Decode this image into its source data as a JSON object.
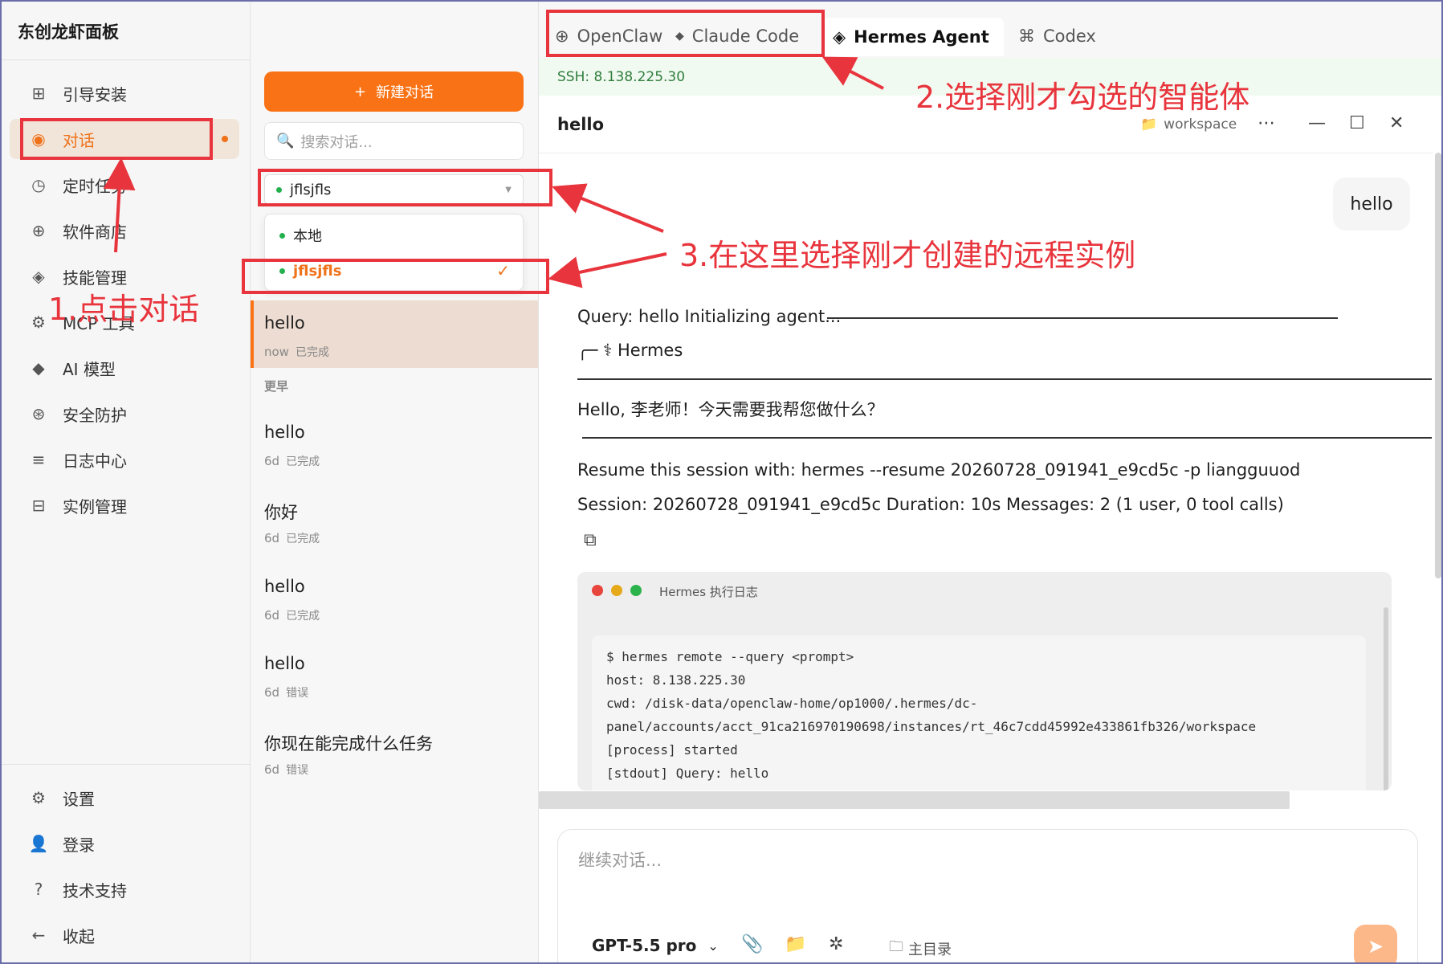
{
  "app": {
    "brand": "东创龙虾面板"
  },
  "sidebar": {
    "items": [
      {
        "icon": "grid-icon",
        "glyph": "⊞",
        "label": "引导安装"
      },
      {
        "icon": "chat-icon",
        "glyph": "◉",
        "label": "对话"
      },
      {
        "icon": "clock-icon",
        "glyph": "◷",
        "label": "定时任务"
      },
      {
        "icon": "store-icon",
        "glyph": "⊕",
        "label": "软件商店"
      },
      {
        "icon": "skill-icon",
        "glyph": "◈",
        "label": "技能管理"
      },
      {
        "icon": "tool-icon",
        "glyph": "⚙",
        "label": "MCP 工具"
      },
      {
        "icon": "model-icon",
        "glyph": "◆",
        "label": "AI 模型"
      },
      {
        "icon": "shield-icon",
        "glyph": "⊛",
        "label": "安全防护"
      },
      {
        "icon": "log-icon",
        "glyph": "≡",
        "label": "日志中心"
      },
      {
        "icon": "instance-icon",
        "glyph": "⊟",
        "label": "实例管理"
      }
    ],
    "bottom": [
      {
        "icon": "gear-icon",
        "glyph": "⚙",
        "label": "设置"
      },
      {
        "icon": "user-icon",
        "glyph": "👤",
        "label": "登录"
      },
      {
        "icon": "help-icon",
        "glyph": "?",
        "label": "技术支持"
      },
      {
        "icon": "collapse-icon",
        "glyph": "←",
        "label": "收起"
      }
    ]
  },
  "list": {
    "new_chat": "新建对话",
    "search_placeholder": "搜索对话...",
    "selected_instance": "jflsjfls",
    "dropdown_options": [
      "本地",
      "jflsjfls"
    ],
    "recent": {
      "title": "hello",
      "time": "now",
      "status": "已完成"
    },
    "section_earlier": "更早",
    "earlier": [
      {
        "title": "hello",
        "time": "6d",
        "status": "已完成"
      },
      {
        "title": "你好",
        "time": "6d",
        "status": "已完成"
      },
      {
        "title": "hello",
        "time": "6d",
        "status": "已完成"
      },
      {
        "title": "hello",
        "time": "6d",
        "status": "错误"
      },
      {
        "title": "你现在能完成什么任务",
        "time": "6d",
        "status": "错误"
      }
    ]
  },
  "tabs": [
    "OpenClaw",
    "Claude Code",
    "Hermes Agent",
    "Codex"
  ],
  "main": {
    "ssh": "SSH: 8.138.225.30",
    "chat_title": "hello",
    "workspace": "workspace",
    "user_message": "hello",
    "output": {
      "query_line": "Query: hello Initializing agent...",
      "hermes_label": "╭─ ⚕ Hermes",
      "greeting": "Hello, 李老师！今天需要我帮您做什么？",
      "resume": "Resume this session with: hermes --resume 20260728_091941_e9cd5c -p liangguuod",
      "session": "Session: 20260728_091941_e9cd5c Duration: 10s Messages: 2 (1 user, 0 tool calls)"
    },
    "log": {
      "title": "Hermes 执行日志",
      "lines": "$ hermes remote --query <prompt>\nhost: 8.138.225.30\ncwd: /disk-data/openclaw-home/op1000/.hermes/dc-\npanel/accounts/acct_91ca216970190698/instances/rt_46c7cdd45992e433861fb326/workspace\n[process] started\n[stdout] Query: hello"
    },
    "composer": {
      "placeholder": "继续对话...",
      "model": "GPT-5.5 pro",
      "home_dir": "主目录"
    }
  },
  "annotations": {
    "step1": "1.点击对话",
    "step2": "2.选择刚才勾选的智能体",
    "step3": "3.在这里选择刚才创建的远程实例"
  },
  "colors": {
    "accent": "#f97316",
    "annotation": "#e8343c",
    "online": "#22b14c"
  }
}
